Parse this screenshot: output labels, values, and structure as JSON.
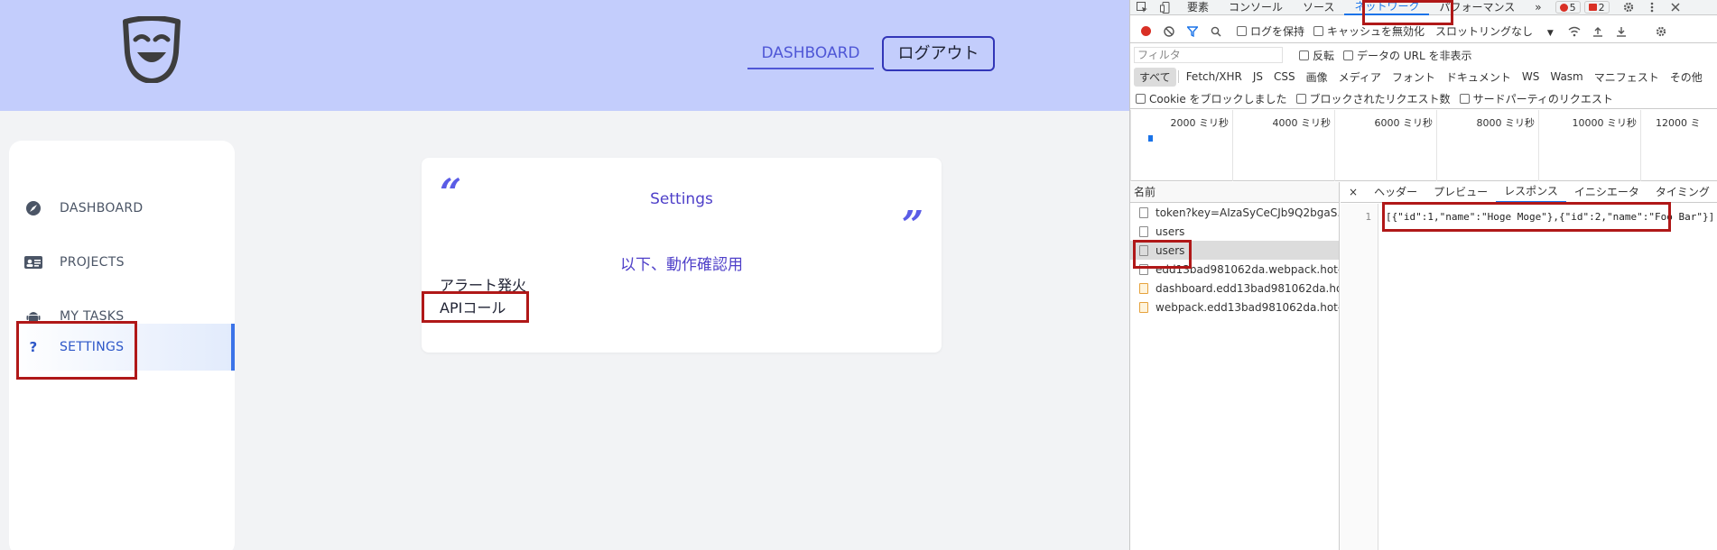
{
  "app": {
    "nav": {
      "dashboard": "DASHBOARD",
      "logout": "ログアウト"
    },
    "sidebar": {
      "items": [
        {
          "label": "DASHBOARD",
          "icon": "compass-icon"
        },
        {
          "label": "PROJECTS",
          "icon": "id-card-icon"
        },
        {
          "label": "MY TASKS",
          "icon": "android-icon"
        },
        {
          "label": "SETTINGS",
          "icon": "question-icon",
          "active": true
        }
      ]
    },
    "card": {
      "quote_open": "“",
      "quote_close": "”",
      "title": "Settings",
      "subtitle": "以下、動作確認用",
      "links": [
        "アラート発火",
        "APIコール"
      ]
    },
    "colors": {
      "header": "#c3cdfc",
      "accent": "#4f57d6",
      "highlight": "#b01818",
      "active_bar": "#3b73e8"
    }
  },
  "devtools": {
    "tabs": [
      "要素",
      "コンソール",
      "ソース",
      "ネットワーク",
      "パフォーマンス"
    ],
    "active_tab": "ネットワーク",
    "more": "»",
    "errors": "5",
    "warnings": "2",
    "toolbar": {
      "preserve_log": "ログを保持",
      "disable_cache": "キャッシュを無効化",
      "throttling": "スロットリングなし",
      "throttling_caret": "▼"
    },
    "filter": {
      "placeholder": "フィルタ",
      "invert": "反転",
      "hide_data_urls": "データの URL を非表示"
    },
    "types": [
      "すべて",
      "Fetch/XHR",
      "JS",
      "CSS",
      "画像",
      "メディア",
      "フォント",
      "ドキュメント",
      "WS",
      "Wasm",
      "マニフェスト",
      "その他"
    ],
    "cookie_row": [
      "Cookie をブロックしました",
      "ブロックされたリクエスト数",
      "サードパーティのリクエスト"
    ],
    "timeline_ticks": [
      "2000 ミリ秒",
      "4000 ミリ秒",
      "6000 ミリ秒",
      "8000 ミリ秒",
      "10000 ミリ秒",
      "12000 ミ"
    ],
    "list_header": "名前",
    "requests": [
      {
        "name": "token?key=AIzaSyCeCJb9Q2bgaS...",
        "type": "doc"
      },
      {
        "name": "users",
        "type": "doc"
      },
      {
        "name": "users",
        "type": "doc",
        "selected": true
      },
      {
        "name": "edd13bad981062da.webpack.hot-...",
        "type": "doc"
      },
      {
        "name": "dashboard.edd13bad981062da.ho...",
        "type": "js"
      },
      {
        "name": "webpack.edd13bad981062da.hot-...",
        "type": "js"
      }
    ],
    "detail_tabs": [
      "×",
      "ヘッダー",
      "プレビュー",
      "レスポンス",
      "イニシエータ",
      "タイミング"
    ],
    "active_detail_tab": "レスポンス",
    "response": {
      "line": "1",
      "text": "[{\"id\":1,\"name\":\"Hoge Moge\"},{\"id\":2,\"name\":\"Foo Bar\"}]"
    }
  }
}
